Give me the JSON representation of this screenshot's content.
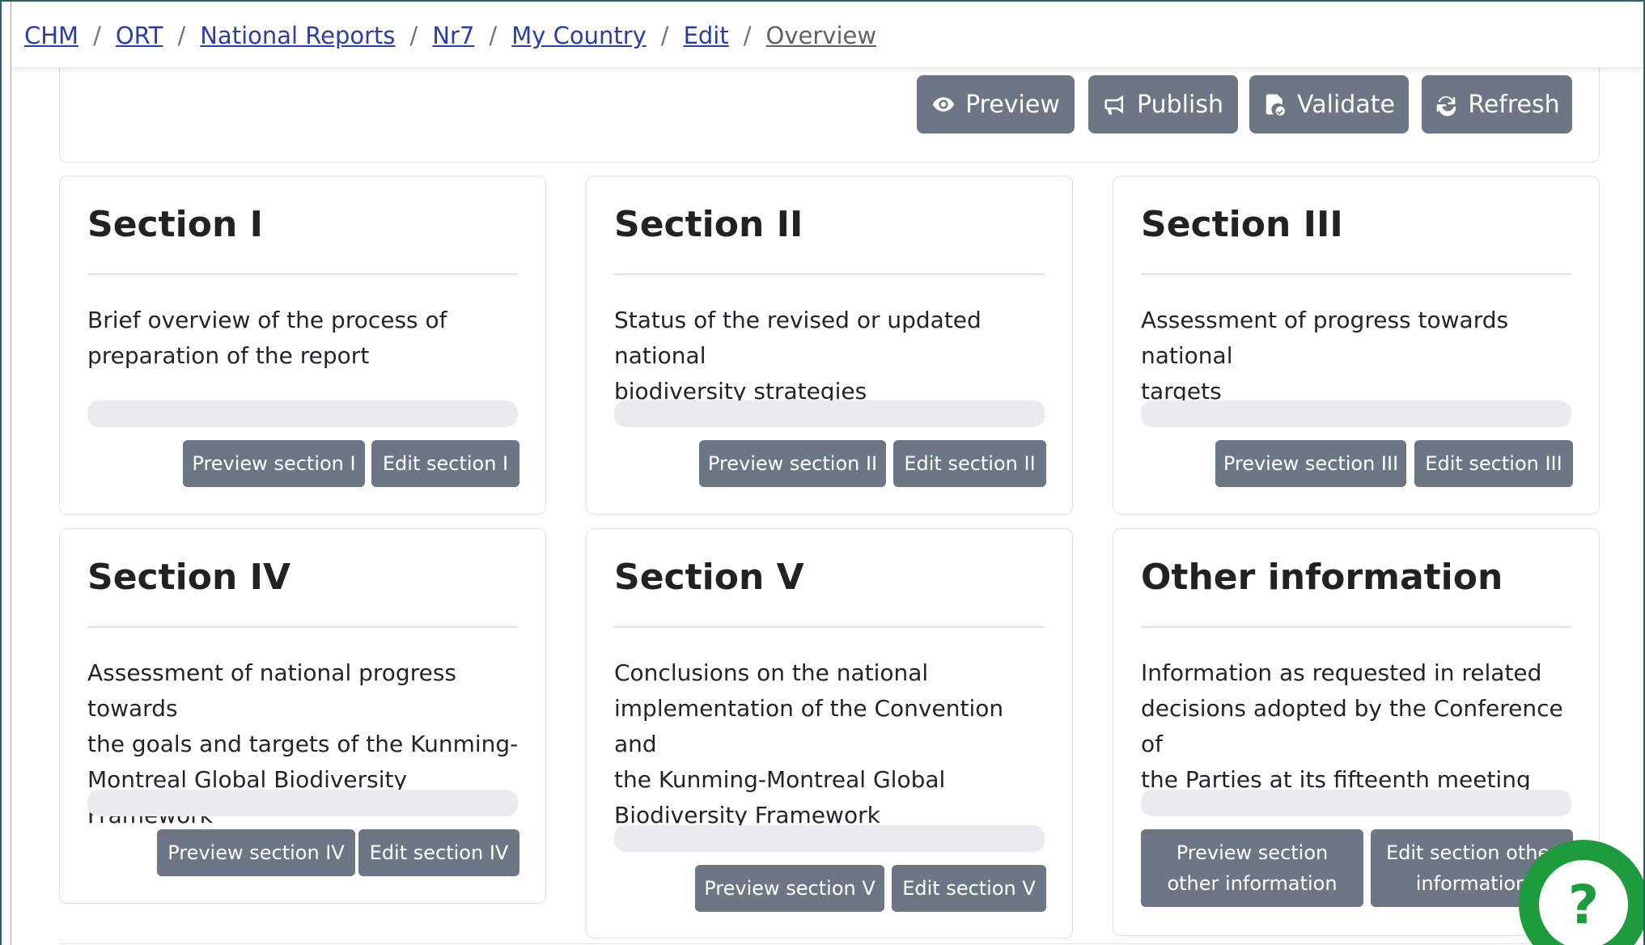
{
  "breadcrumb": [
    {
      "label": "CHM"
    },
    {
      "label": "ORT"
    },
    {
      "label": "National Reports"
    },
    {
      "label": "Nr7"
    },
    {
      "label": "My Country"
    },
    {
      "label": "Edit"
    },
    {
      "label": "Overview"
    }
  ],
  "breadcrumb_separator": "/",
  "toolbar": {
    "preview_label": "Preview",
    "publish_label": "Publish",
    "validate_label": "Validate",
    "refresh_label": "Refresh"
  },
  "sections": [
    {
      "title": "Section I",
      "desc_lines": [
        "Brief overview of the process of",
        "preparation of the report"
      ],
      "preview_label": "Preview section I",
      "edit_label": "Edit section I",
      "progress": 0
    },
    {
      "title": "Section II",
      "desc_lines": [
        "Status of the revised or updated national",
        "biodiversity strategies"
      ],
      "preview_label": "Preview section II",
      "edit_label": "Edit section II",
      "progress": 0
    },
    {
      "title": "Section III",
      "desc_lines": [
        "Assessment of progress towards national",
        "targets"
      ],
      "preview_label": "Preview section III",
      "edit_label": "Edit section III",
      "progress": 0
    },
    {
      "title": "Section IV",
      "desc_lines": [
        "Assessment of national progress towards",
        "the goals and targets of the Kunming-",
        "Montreal Global Biodiversity Framework"
      ],
      "preview_label": "Preview section IV",
      "edit_label": "Edit section IV",
      "progress": 0
    },
    {
      "title": "Section V",
      "desc_lines": [
        "Conclusions on the national",
        "implementation of the Convention and",
        "the Kunming-Montreal Global",
        "Biodiversity Framework"
      ],
      "preview_label": "Preview section V",
      "edit_label": "Edit section V",
      "progress": 0
    },
    {
      "title": "Other information",
      "desc_lines": [
        "Information as requested in related",
        "decisions adopted by the Conference of",
        "the Parties at its fifteenth meeting"
      ],
      "preview_label_lines": [
        "Preview section",
        "other information"
      ],
      "edit_label_lines": [
        "Edit section other",
        "information"
      ],
      "progress": 0
    }
  ],
  "help": {
    "label": "?"
  },
  "colors": {
    "link": "#2b3ea8",
    "button": "#6c7684",
    "help": "#1d9b3d"
  }
}
